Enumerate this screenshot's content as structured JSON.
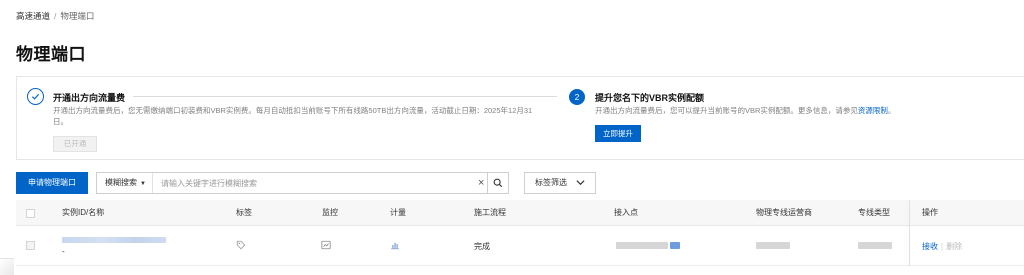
{
  "breadcrumb": {
    "items": [
      "高速通道",
      "物理端口"
    ],
    "separator": "/"
  },
  "page_title": "物理端口",
  "steps": {
    "step1": {
      "title": "开通出方向流量费",
      "description": "开通出方向流量费后，您无需缴纳端口初装费和VBR实例费。每月自动抵扣当前账号下所有线路50TB出方向流量，活动截止日期：2025年12月31日。",
      "button_label": "已开通"
    },
    "step2": {
      "number": "2",
      "title": "提升您名下的VBR实例配额",
      "description_prefix": "开通出方向流量费后，您可以提升当前账号的VBR实例配额。更多信息，请参见",
      "description_link": "资源限制",
      "description_suffix": "。",
      "button_label": "立即提升"
    }
  },
  "toolbar": {
    "apply_button": "申请物理端口",
    "search_type": "模糊搜索",
    "search_placeholder": "请输入关键字进行模糊搜索",
    "tag_filter": "标签筛选"
  },
  "table": {
    "columns": [
      "实例ID/名称",
      "标签",
      "监控",
      "计量",
      "施工流程",
      "接入点",
      "物理专线运营商",
      "专线类型",
      "操作"
    ],
    "rows": [
      {
        "instance_name": "-",
        "construction_status": "完成",
        "actions": [
          "接收",
          "删除"
        ]
      }
    ]
  },
  "colors": {
    "primary": "#0064c8",
    "disabled_text": "#bbbbbb",
    "header_bg": "#f7f7f7"
  },
  "icons": {
    "step1": "check-circle-icon",
    "tag": "tag-icon",
    "monitor": "monitor-chart-icon",
    "metering": "bar-chart-icon",
    "search": "search-icon",
    "clear": "close-icon",
    "dropdown": "chevron-down-icon"
  }
}
